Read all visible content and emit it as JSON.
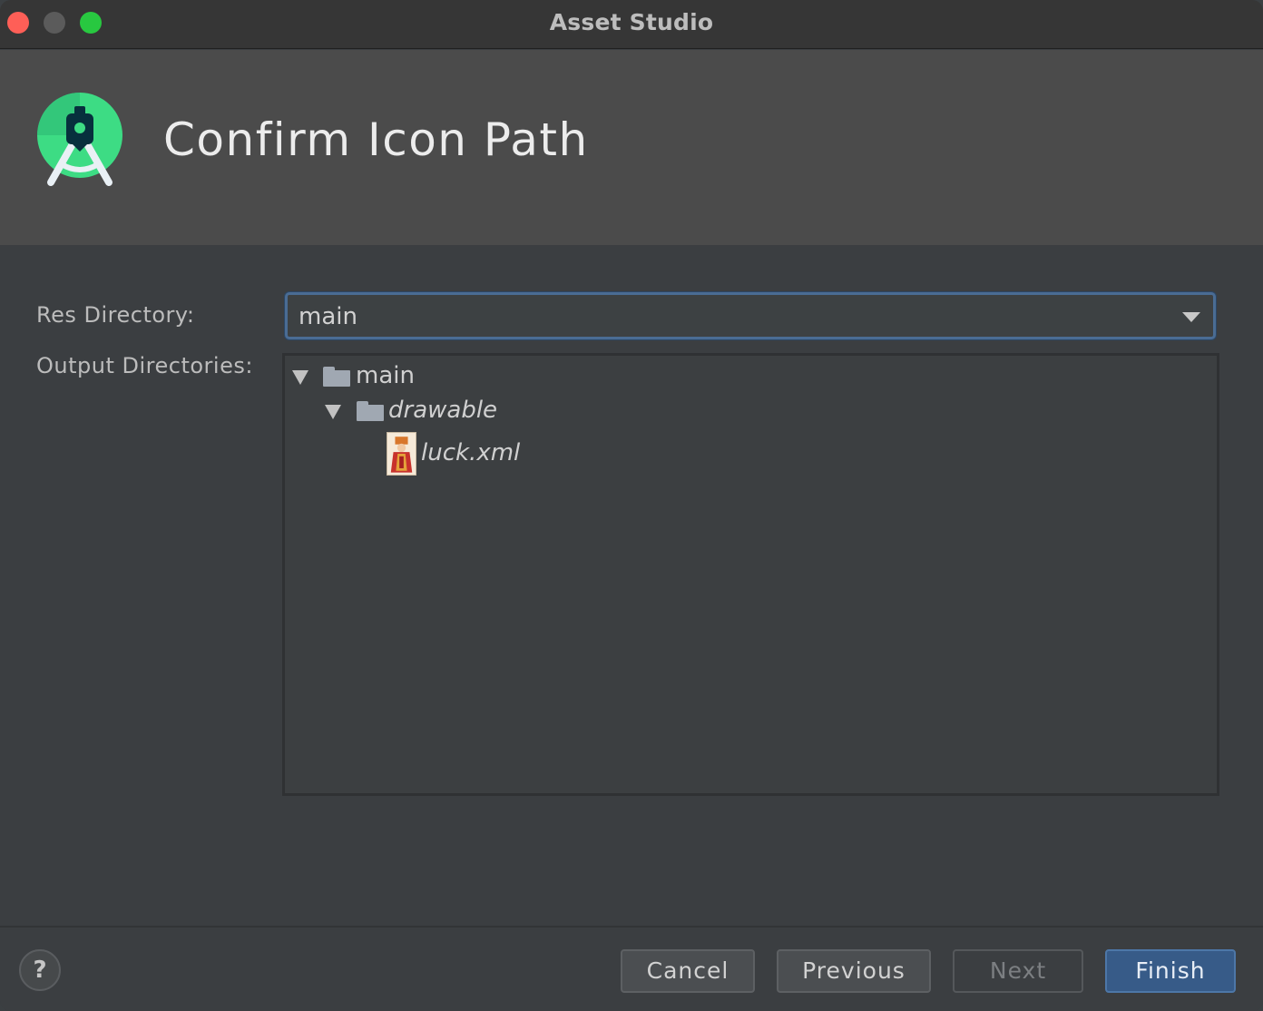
{
  "window": {
    "title": "Asset Studio"
  },
  "header": {
    "title": "Confirm Icon Path"
  },
  "form": {
    "res_directory_label": "Res Directory:",
    "res_directory_value": "main",
    "output_directories_label": "Output Directories:"
  },
  "tree": {
    "nodes": [
      {
        "label": "main",
        "type": "folder",
        "expanded": true
      },
      {
        "label": "drawable",
        "type": "folder",
        "expanded": true
      },
      {
        "label": "luck.xml",
        "type": "file"
      }
    ]
  },
  "footer": {
    "help_label": "?",
    "cancel_label": "Cancel",
    "previous_label": "Previous",
    "next_label": "Next",
    "finish_label": "Finish"
  },
  "colors": {
    "primary_button": "#375b88",
    "focus_border": "#4a6c94",
    "logo_green": "#3ddc84"
  }
}
